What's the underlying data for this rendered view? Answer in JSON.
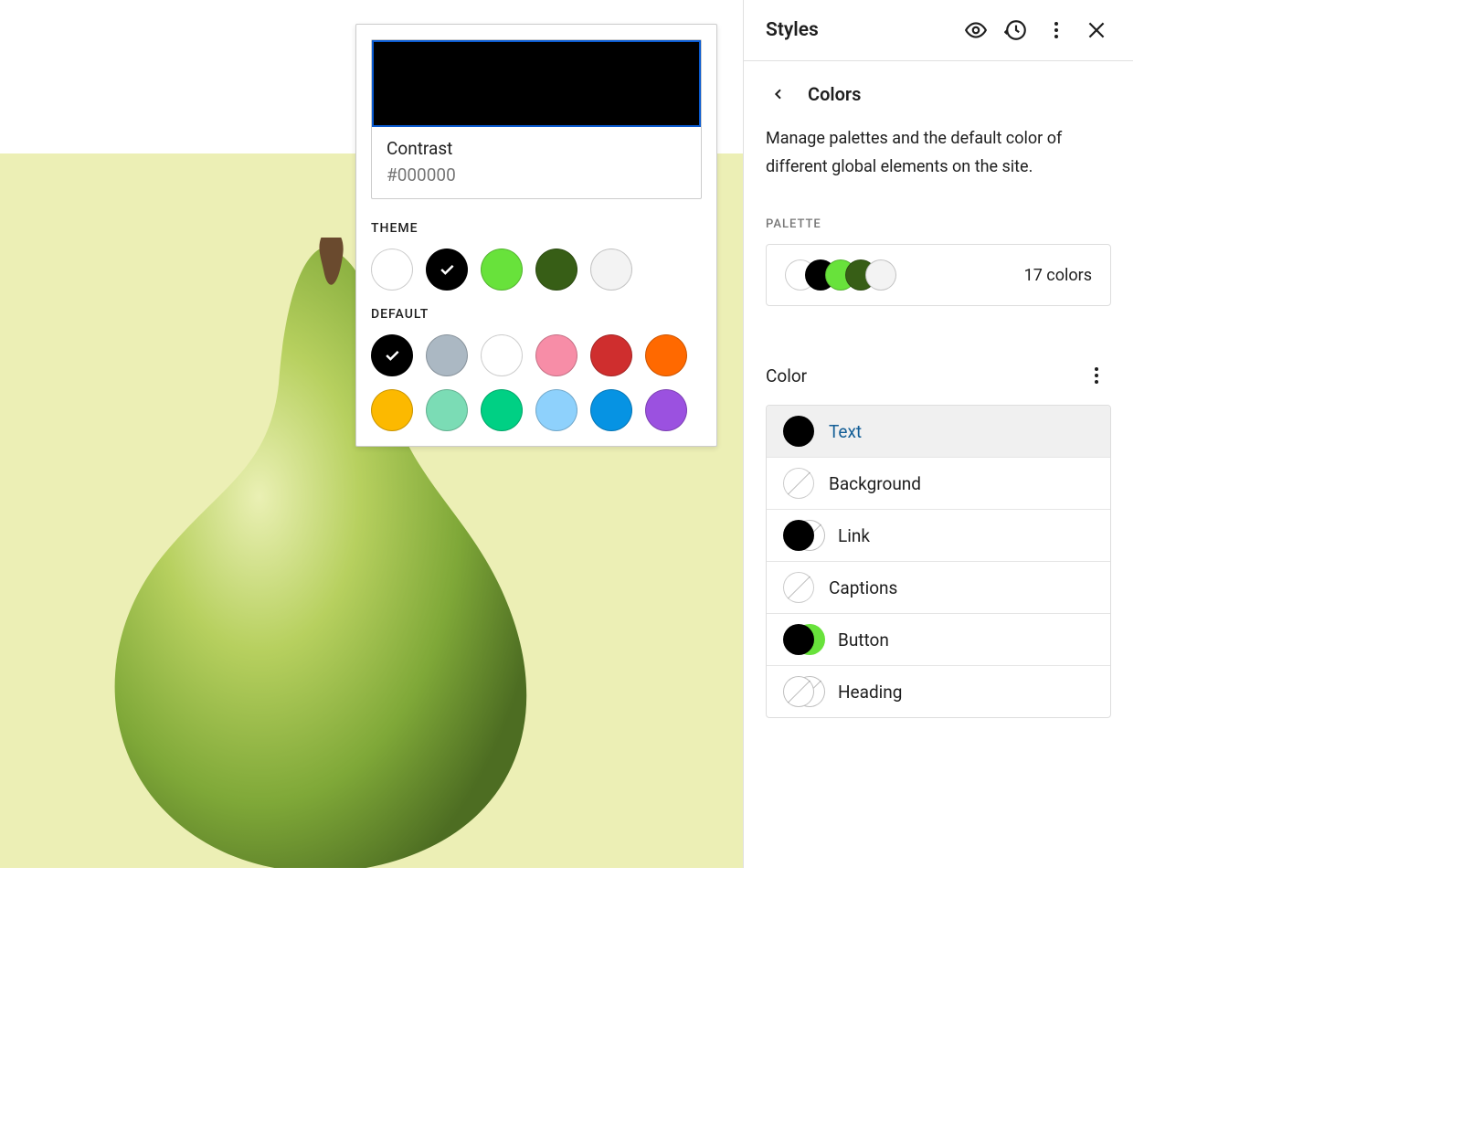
{
  "sidebar": {
    "title": "Styles",
    "crumb": "Colors",
    "description": "Manage palettes and the default color of different global elements on the site.",
    "palette_label": "PALETTE",
    "palette_count": "17 colors",
    "palette_preview": [
      "#ffffff",
      "#000000",
      "#68e23b",
      "#375e16",
      "#f3f3f3"
    ],
    "color_section": "Color",
    "color_items": [
      {
        "label": "Text",
        "type": "solid",
        "color": "#000000",
        "active": true
      },
      {
        "label": "Background",
        "type": "empty"
      },
      {
        "label": "Link",
        "type": "link"
      },
      {
        "label": "Captions",
        "type": "empty"
      },
      {
        "label": "Button",
        "type": "button"
      },
      {
        "label": "Heading",
        "type": "double-empty"
      }
    ]
  },
  "popover": {
    "selected_name": "Contrast",
    "selected_hex": "#000000",
    "theme_label": "THEME",
    "default_label": "DEFAULT",
    "theme": [
      {
        "c": "#ffffff",
        "sel": false
      },
      {
        "c": "#000000",
        "sel": true
      },
      {
        "c": "#68e23b",
        "sel": false
      },
      {
        "c": "#375e16",
        "sel": false
      },
      {
        "c": "#f3f3f3",
        "sel": false
      }
    ],
    "default": [
      {
        "c": "#000000",
        "sel": true
      },
      {
        "c": "#abb8c3",
        "sel": false
      },
      {
        "c": "#ffffff",
        "sel": false
      },
      {
        "c": "#f78da7",
        "sel": false
      },
      {
        "c": "#cf2e2e",
        "sel": false
      },
      {
        "c": "#ff6900",
        "sel": false
      },
      {
        "c": "#fcb900",
        "sel": false
      },
      {
        "c": "#7bdcb5",
        "sel": false
      },
      {
        "c": "#00d084",
        "sel": false
      },
      {
        "c": "#8ed1fc",
        "sel": false
      },
      {
        "c": "#0693e3",
        "sel": false
      },
      {
        "c": "#9b51e0",
        "sel": false
      }
    ]
  }
}
